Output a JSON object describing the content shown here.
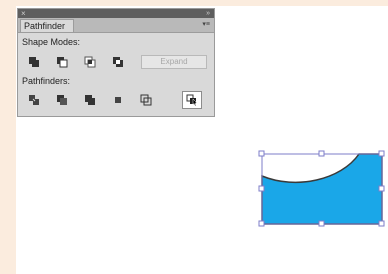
{
  "panel": {
    "tab_label": "Pathfinder",
    "menu_icon": "panel-menu-icon",
    "shape_modes_label": "Shape Modes:",
    "pathfinders_label": "Pathfinders:",
    "expand_label": "Expand",
    "shape_mode_buttons": [
      "unite-icon",
      "minus-front-icon",
      "intersect-icon",
      "exclude-icon"
    ],
    "pathfinder_buttons": [
      "divide-icon",
      "trim-icon",
      "merge-icon",
      "crop-icon",
      "outline-icon",
      "minus-back-icon"
    ],
    "selected_pathfinder": "minus-back-icon"
  },
  "artwork": {
    "fill_color": "#1aa7e8",
    "stroke_color": "#3a3a3a",
    "selection_color": "#7d7dc8"
  }
}
